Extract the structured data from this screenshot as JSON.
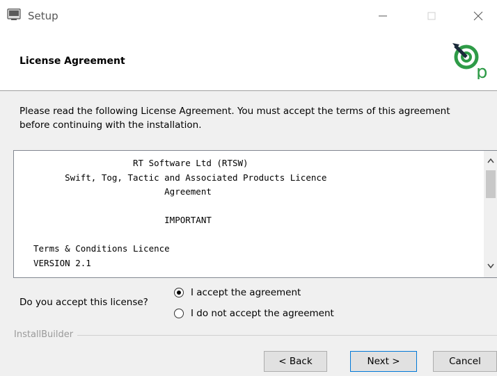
{
  "window": {
    "title": "Setup",
    "controls": [
      "minimize-icon",
      "maximize-icon",
      "close-icon"
    ]
  },
  "header": {
    "title": "License Agreement",
    "logo": "target-p-logo-icon"
  },
  "intro": {
    "text": "Please read the following License Agreement. You must accept the terms of this agreement before continuing with the installation."
  },
  "license": {
    "lines": [
      "                   RT Software Ltd (RTSW)",
      "      Swift, Tog, Tactic and Associated Products Licence",
      "                         Agreement",
      "",
      "                         IMPORTANT",
      "",
      "Terms & Conditions Licence",
      "VERSION 2.1"
    ]
  },
  "accept": {
    "question": "Do you accept this license?",
    "options": [
      {
        "label": "I accept the agreement",
        "selected": true
      },
      {
        "label": "I do not accept the agreement",
        "selected": false
      }
    ]
  },
  "footer": {
    "brand": "InstallBuilder",
    "back_label": "< Back",
    "next_label": "Next >",
    "cancel_label": "Cancel"
  },
  "colors": {
    "background": "#f0f0f0",
    "accent": "#0078d7",
    "logo_green": "#2e9b47"
  }
}
